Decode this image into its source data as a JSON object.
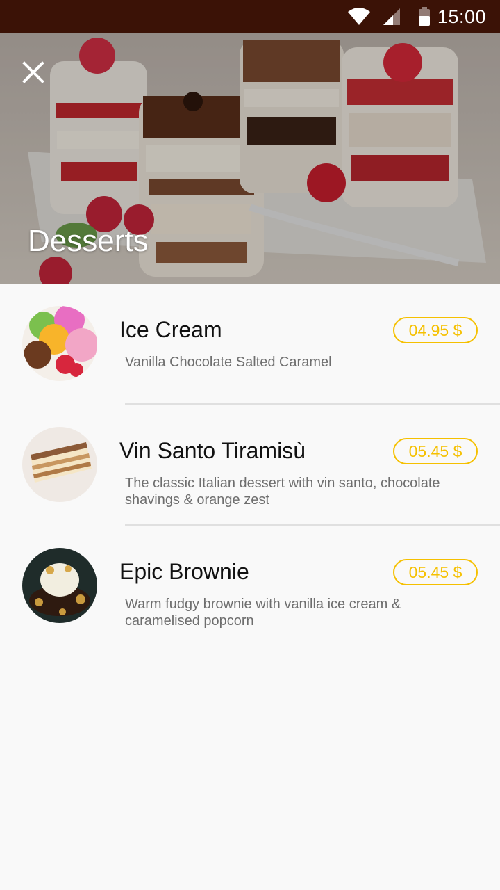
{
  "status_bar": {
    "time": "15:00",
    "icons": [
      "wifi-icon",
      "cell-signal-icon",
      "battery-icon"
    ],
    "background": "#3b1206"
  },
  "header": {
    "title": "Desserts",
    "close_icon": "close-icon"
  },
  "menu": {
    "accent_color": "#f5c000",
    "items": [
      {
        "name": "Ice Cream",
        "description": "Vanilla Chocolate Salted Caramel",
        "price": "04.95 $",
        "image": "ice-cream-scoops"
      },
      {
        "name": "Vin Santo Tiramisù",
        "description": "The classic Italian dessert with vin santo, chocolate shavings & orange zest",
        "price": "05.45 $",
        "image": "tiramisu-slice"
      },
      {
        "name": "Epic Brownie",
        "description": "Warm fudgy brownie with vanilla ice cream & caramelised popcorn",
        "price": "05.45 $",
        "image": "brownie-with-ice-cream"
      }
    ]
  }
}
